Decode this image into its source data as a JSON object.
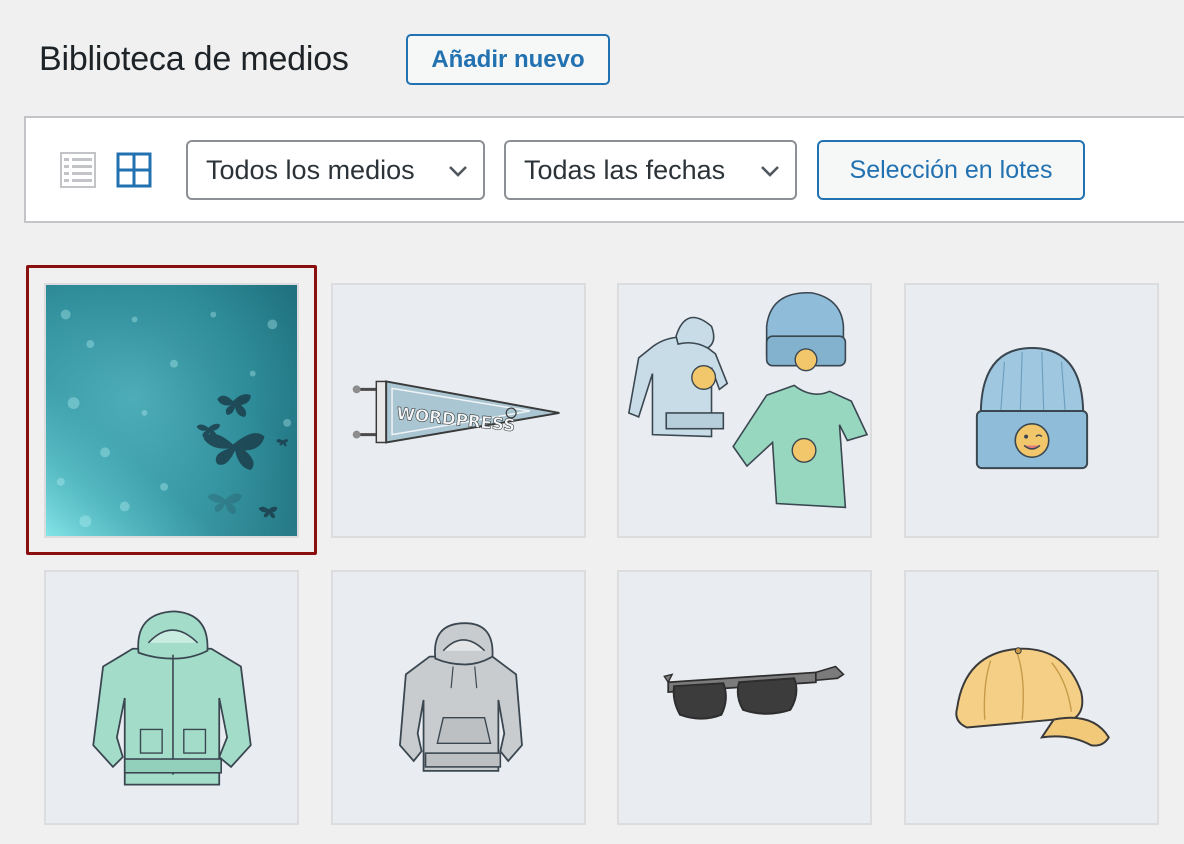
{
  "header": {
    "title": "Biblioteca de medios",
    "add_new_label": "Añadir nuevo"
  },
  "toolbar": {
    "view_modes": [
      {
        "name": "list-view",
        "icon": "list-icon",
        "active": false
      },
      {
        "name": "grid-view",
        "icon": "grid-icon",
        "active": true
      }
    ],
    "media_type_filter": {
      "selected": "Todos los medios"
    },
    "date_filter": {
      "selected": "Todas las fechas"
    },
    "bulk_select_label": "Selección en lotes"
  },
  "media_grid": {
    "selected_index": 0,
    "items": [
      {
        "depicts": "teal bokeh background with butterflies"
      },
      {
        "depicts": "pennant"
      },
      {
        "depicts": "hoodie beanie and t-shirt"
      },
      {
        "depicts": "beanie"
      },
      {
        "depicts": "zip hoodie"
      },
      {
        "depicts": "grey hoodie"
      },
      {
        "depicts": "sunglasses"
      },
      {
        "depicts": "cap"
      }
    ]
  },
  "colors": {
    "accent": "#2271b1",
    "page_bg": "#f0f0f1",
    "selection_ring": "#8a0f0f",
    "tile_bg": "#e9ecf1"
  }
}
